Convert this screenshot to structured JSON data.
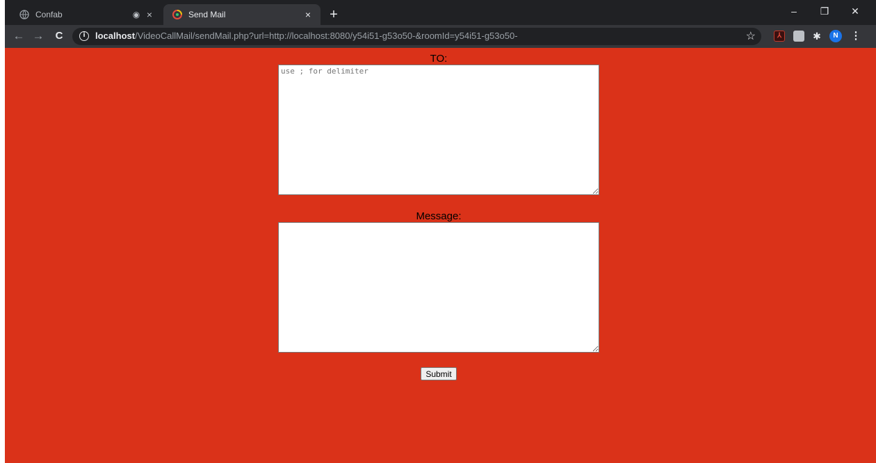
{
  "browser": {
    "tabs": [
      {
        "title": "Confab",
        "favicon": "globe-icon",
        "audio_indicator": "◉",
        "close": "×"
      },
      {
        "title": "Send Mail",
        "favicon": "app-favicon-icon",
        "close": "×"
      }
    ],
    "new_tab": "+",
    "window_controls": {
      "minimize": "–",
      "restore": "❐",
      "close": "✕"
    },
    "nav": {
      "back": "←",
      "forward": "→",
      "reload": "C"
    },
    "address": {
      "host": "localhost",
      "path": "/VideoCallMail/sendMail.php?url=http://localhost:8080/y54i51-g53o50-&roomId=y54i51-g53o50-",
      "info_icon": "i",
      "bookmark": "☆"
    },
    "extensions": {
      "pdf": "⅄",
      "puzzle": "✱"
    },
    "profile_initial": "N",
    "menu": "⋮"
  },
  "form": {
    "to_label": "TO:",
    "to_placeholder": "use ; for delimiter",
    "to_value": "",
    "message_label": "Message:",
    "message_value": "",
    "submit_label": "Submit"
  },
  "colors": {
    "page_background": "#da3219",
    "tabstrip": "#202124",
    "toolbar": "#35363a"
  }
}
